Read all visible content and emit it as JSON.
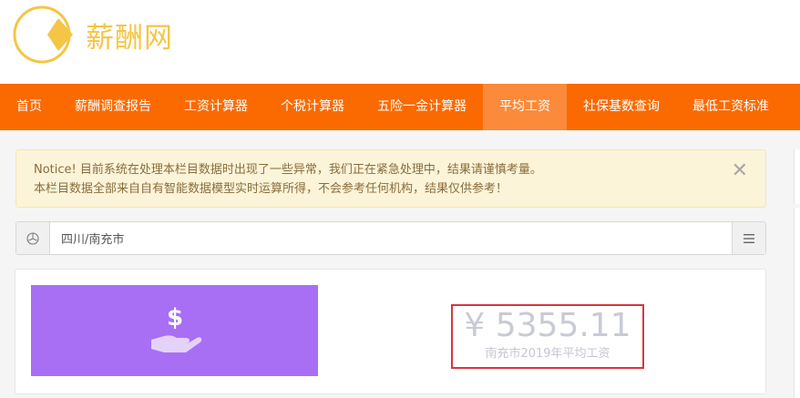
{
  "site": {
    "name": "薪酬网"
  },
  "nav": {
    "items": [
      {
        "label": "首页",
        "active": false
      },
      {
        "label": "薪酬调查报告",
        "active": false
      },
      {
        "label": "工资计算器",
        "active": false
      },
      {
        "label": "个税计算器",
        "active": false
      },
      {
        "label": "五险一金计算器",
        "active": false
      },
      {
        "label": "平均工资",
        "active": true
      },
      {
        "label": "社保基数查询",
        "active": false
      },
      {
        "label": "最低工资标准",
        "active": false
      }
    ]
  },
  "notice": {
    "line1": "Notice! 目前系统在处理本栏目数据时出现了一些异常，我们正在紧急处理中，结果请谨慎考量。",
    "line2": "本栏目数据全部来自自有智能数据模型实时运算所得，不会参考任何机构，结果仅供参考！",
    "close": "✕"
  },
  "region": {
    "value": "四川/南充市"
  },
  "result": {
    "amount": "¥ 5355.11",
    "label": "南充市2019年平均工资"
  },
  "colors": {
    "nav_bg": "#fa6a00",
    "nav_active": "#fb8a3a",
    "logo": "#f5c545",
    "icon_card": "#a86ff5",
    "highlight_border": "#d9363e"
  },
  "icons": [
    "logo-pie-icon",
    "location-icon",
    "list-icon",
    "dollar-hand-icon",
    "close-icon"
  ]
}
